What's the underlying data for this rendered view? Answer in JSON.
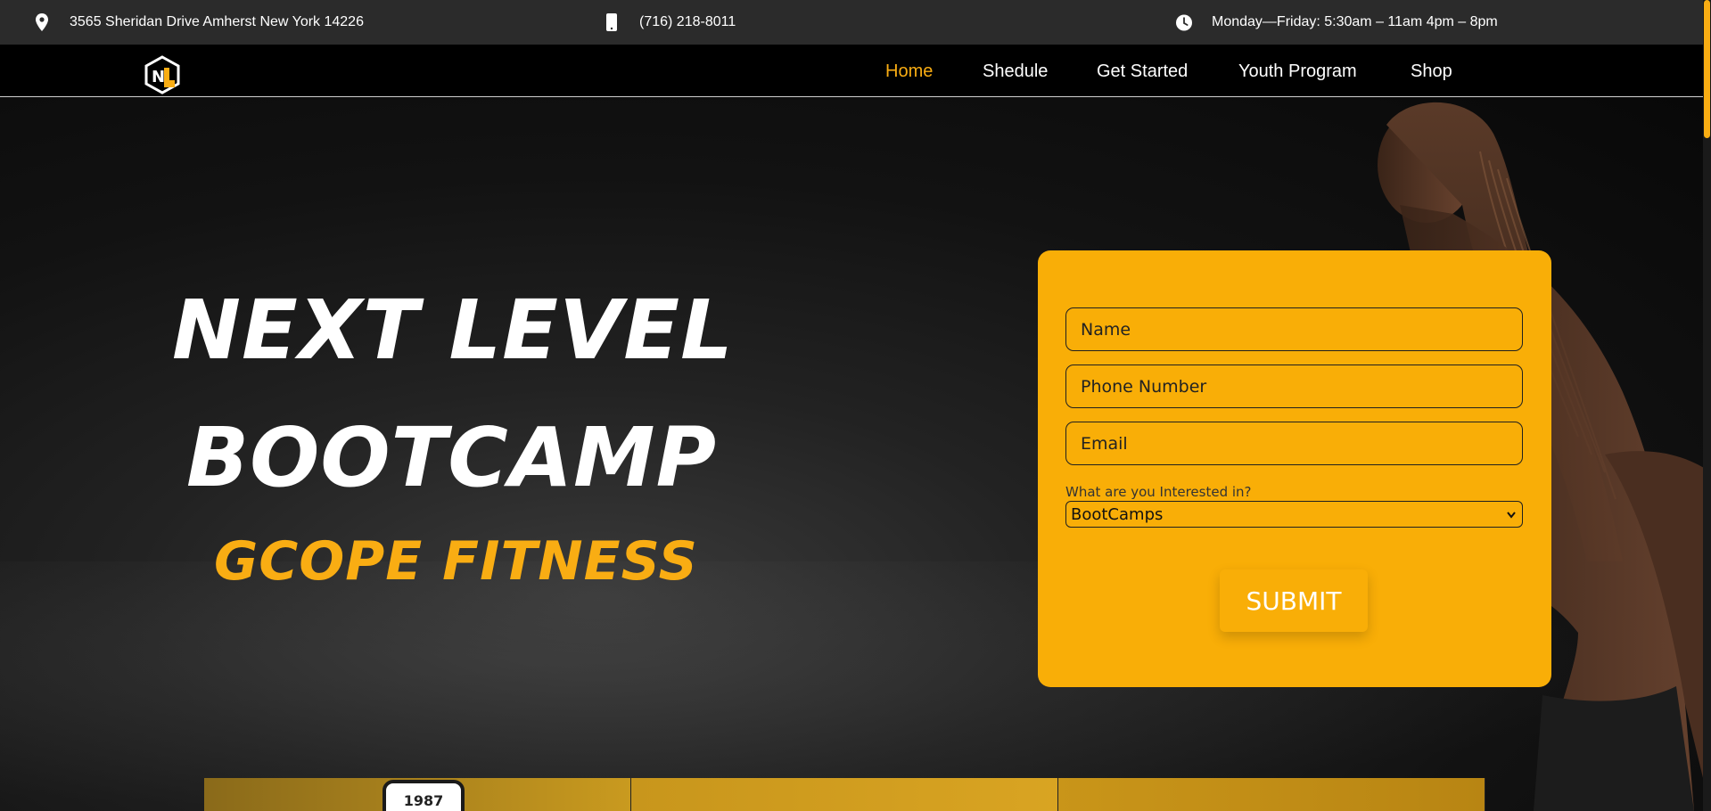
{
  "topbar": {
    "address": "3565 Sheridan Drive Amherst New York 14226",
    "phone": "(716) 218-8011",
    "hours": "Monday—Friday: 5:30am – 11am 4pm – 8pm",
    "icons": [
      "location-pin-icon",
      "mobile-phone-icon",
      "clock-icon"
    ]
  },
  "nav": {
    "items": [
      "Home",
      "Shedule",
      "Get Started",
      "Youth Program",
      "Shop"
    ],
    "active": "Home"
  },
  "hero": {
    "title_line1": "NEXT LEVEL",
    "title_line2": "BOOTCAMP",
    "subtitle": "GCOPE FITNESS"
  },
  "form": {
    "name_placeholder": "Name",
    "phone_placeholder": "Phone Number",
    "email_placeholder": "Email",
    "interest_label": "What are you Interested in?",
    "interest_selected": "BootCamps",
    "submit_label": "SUBMIT"
  },
  "panels": {
    "badge_text": "1987"
  },
  "colors": {
    "accent": "#f9ad13",
    "topbar_bg": "#2b2b2b",
    "nav_bg": "#000000",
    "form_bg": "#f9ae07"
  }
}
